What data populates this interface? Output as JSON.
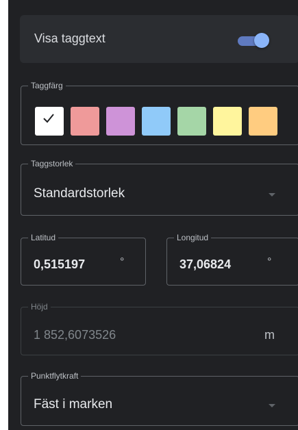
{
  "show_tag_text": {
    "label": "Visa taggtext",
    "enabled": true
  },
  "tag_color": {
    "legend": "Taggfärg",
    "selected_index": 0,
    "swatches": [
      {
        "name": "white",
        "color": "#ffffff"
      },
      {
        "name": "red",
        "color": "#ef9a9a"
      },
      {
        "name": "purple",
        "color": "#ce93d8"
      },
      {
        "name": "blue",
        "color": "#90caf9"
      },
      {
        "name": "green",
        "color": "#a5d6a7"
      },
      {
        "name": "yellow",
        "color": "#fff59d"
      },
      {
        "name": "orange",
        "color": "#ffcc80"
      }
    ]
  },
  "tag_size": {
    "legend": "Taggstorlek",
    "value": "Standardstorlek"
  },
  "latitude": {
    "legend": "Latitud",
    "value": "0,515197",
    "unit": "°"
  },
  "longitude": {
    "legend": "Longitud",
    "value": "37,06824",
    "unit": "°"
  },
  "height": {
    "legend": "Höjd",
    "value": "1 852,6073526",
    "unit": "m"
  },
  "point_float": {
    "legend": "Punktflytkraft",
    "value": "Fäst i marken"
  },
  "colors": {
    "panel_bg": "#202124",
    "row_bg": "#2b2d31",
    "accent": "#8ab4f8"
  }
}
